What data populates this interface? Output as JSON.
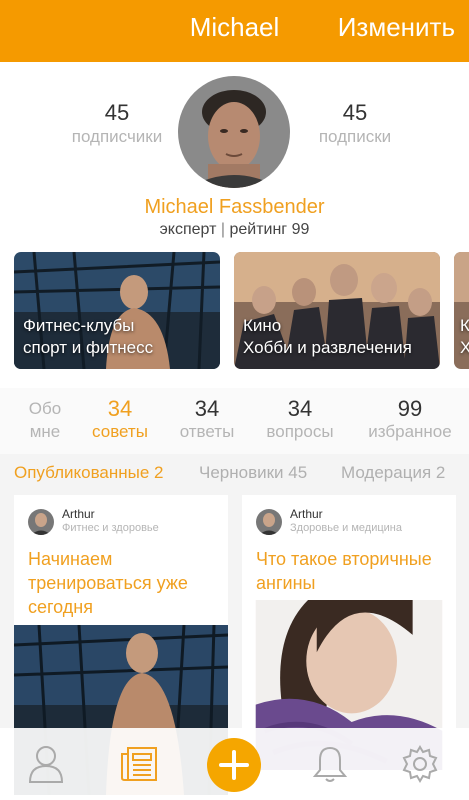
{
  "header": {
    "title": "Michael",
    "edit_label": "Изменить"
  },
  "profile": {
    "followers": {
      "count": "45",
      "label": "подписчики"
    },
    "following": {
      "count": "45",
      "label": "подписки"
    },
    "name": "Michael Fassbender",
    "role": "эксперт",
    "rating_label": "рейтинг",
    "rating_value": "99"
  },
  "categories": [
    {
      "title": "Фитнес-клубы",
      "subtitle": "спорт и фитнесс"
    },
    {
      "title": "Кино",
      "subtitle": "Хобби и развлечения"
    },
    {
      "title": "К",
      "subtitle": "Х"
    }
  ],
  "tabs": [
    {
      "count": "Обо",
      "label": "мне"
    },
    {
      "count": "34",
      "label": "советы"
    },
    {
      "count": "34",
      "label": "ответы"
    },
    {
      "count": "34",
      "label": "вопросы"
    },
    {
      "count": "99",
      "label": "избранное"
    }
  ],
  "subtabs": [
    "Опубликованные 2",
    "Черновики 45",
    "Модерация 2"
  ],
  "posts": [
    {
      "author": "Arthur",
      "category": "Фитнес и здоровье",
      "title": "Начинаем тренироваться уже сегодня"
    },
    {
      "author": "Arthur",
      "category": "Здоровье и медицина",
      "title": "Что такое вторичные ангины"
    }
  ],
  "icons": [
    "user-icon",
    "news-icon",
    "plus-icon",
    "bell-icon",
    "gear-icon"
  ],
  "colors": {
    "accent": "#f59a00",
    "accent_text": "#f0a020",
    "muted": "#b5b5b5"
  }
}
